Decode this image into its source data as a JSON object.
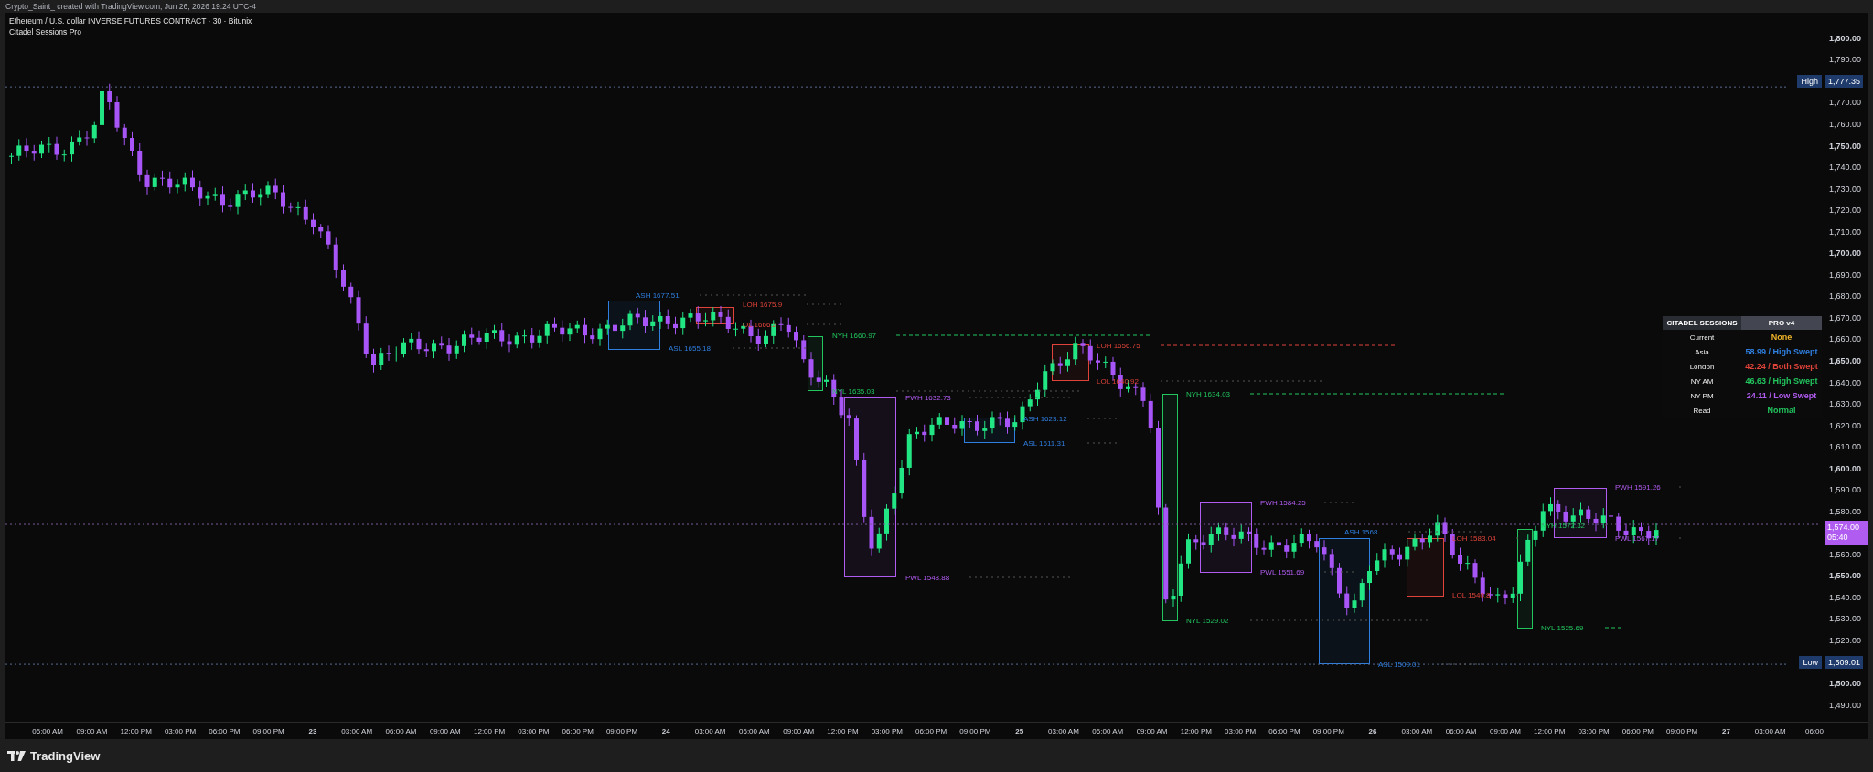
{
  "header": {
    "text": "Crypto_Saint_ created with TradingView.com, Jun 26, 2026 19:24 UTC-4"
  },
  "legend": {
    "symbol": "Ethereum / U.S. dollar INVERSE FUTURES CONTRACT · 30 · Bitunix",
    "indicator": "Citadel Sessions Pro"
  },
  "sessions": [
    {
      "high_label": "ASH 1677.51",
      "low_label": "ASL 1655.18",
      "color": "#2f7fe0",
      "high_line": false,
      "low_line": false
    },
    {
      "high_label": "LOH 1675.9",
      "low_label": "OL 1666.2",
      "color": "#e0433a",
      "high_line": false,
      "low_line": false
    },
    {
      "high_label": "NYH 1660.97",
      "low_label": "NYL 1635.03",
      "color": "#22c55e",
      "high_line": true,
      "low_line": false
    },
    {
      "high_label": "PWH 1632.73",
      "low_label": "PWL 1548.88",
      "color": "#b15cf0",
      "high_line": false,
      "low_line": false
    },
    {
      "high_label": "ASH 1623.12",
      "low_label": "ASL 1611.31",
      "color": "#2f7fe0",
      "high_line": false,
      "low_line": false
    },
    {
      "high_label": "LOH 1656.75",
      "low_label": "LOL 1640.92",
      "color": "#e0433a",
      "high_line": true,
      "low_line": false
    },
    {
      "high_label": "NYH 1634.03",
      "low_label": "NYL 1529.02",
      "color": "#22c55e",
      "high_line": true,
      "low_line": false
    },
    {
      "high_label": "PWH 1584.25",
      "low_label": "PWL 1551.69",
      "color": "#b15cf0",
      "high_line": false,
      "low_line": false
    },
    {
      "high_label": "ASH 1568",
      "low_label": "ASL 1509.01",
      "color": "#2f7fe0",
      "high_line": false,
      "low_line": false
    },
    {
      "high_label": "LOH 1583.04",
      "low_label": "LOL 1540.8",
      "color": "#e0433a",
      "high_line": false,
      "low_line": false
    },
    {
      "high_label": "NYH 1572.32",
      "low_label": "NYL 1525.69",
      "color": "#22c55e",
      "high_line": false,
      "low_line": true
    },
    {
      "high_label": "PWH 1591.26",
      "low_label": "PWL 1567.17",
      "color": "#b15cf0",
      "high_line": false,
      "low_line": false
    }
  ],
  "sessions_table": {
    "title": "CITADEL SESSIONS",
    "version": "PRO v4",
    "rows": [
      {
        "label": "Current",
        "value": "None",
        "color": "#f0b429"
      },
      {
        "label": "Asia",
        "value": "58.99 / High Swept",
        "color": "#2f7fe0"
      },
      {
        "label": "London",
        "value": "42.24 / Both Swept",
        "color": "#e0433a"
      },
      {
        "label": "NY AM",
        "value": "46.63 / High Swept",
        "color": "#22c55e"
      },
      {
        "label": "NY PM",
        "value": "24.11 / Low Swept",
        "color": "#b15cf0"
      },
      {
        "label": "Read",
        "value": "Normal",
        "color": "#22c55e"
      }
    ]
  },
  "price_axis": [
    {
      "kind": "tick",
      "label": "1,800.00",
      "major": true
    },
    {
      "kind": "tick",
      "label": "1,790.00",
      "major": false
    },
    {
      "kind": "tag",
      "tag": "High",
      "label": "1,777.35"
    },
    {
      "kind": "tick",
      "label": "1,770.00",
      "major": false
    },
    {
      "kind": "tick",
      "label": "1,760.00",
      "major": false
    },
    {
      "kind": "tick",
      "label": "1,750.00",
      "major": true
    },
    {
      "kind": "tick",
      "label": "1,740.00",
      "major": false
    },
    {
      "kind": "tick",
      "label": "1,730.00",
      "major": false
    },
    {
      "kind": "tick",
      "label": "1,720.00",
      "major": false
    },
    {
      "kind": "tick",
      "label": "1,710.00",
      "major": false
    },
    {
      "kind": "tick",
      "label": "1,700.00",
      "major": true
    },
    {
      "kind": "tick",
      "label": "1,690.00",
      "major": false
    },
    {
      "kind": "tick",
      "label": "1,680.00",
      "major": false
    },
    {
      "kind": "tick",
      "label": "1,670.00",
      "major": false
    },
    {
      "kind": "tick",
      "label": "1,660.00",
      "major": false
    },
    {
      "kind": "tick",
      "label": "1,650.00",
      "major": true
    },
    {
      "kind": "tick",
      "label": "1,640.00",
      "major": false
    },
    {
      "kind": "tick",
      "label": "1,630.00",
      "major": false
    },
    {
      "kind": "tick",
      "label": "1,620.00",
      "major": false
    },
    {
      "kind": "tick",
      "label": "1,610.00",
      "major": false
    },
    {
      "kind": "tick",
      "label": "1,600.00",
      "major": true
    },
    {
      "kind": "tick",
      "label": "1,590.00",
      "major": false
    },
    {
      "kind": "tick",
      "label": "1,580.00",
      "major": false
    },
    {
      "kind": "price",
      "label": "1,574.00",
      "countdown": "05:40"
    },
    {
      "kind": "tick",
      "label": "1,560.00",
      "major": false
    },
    {
      "kind": "tick",
      "label": "1,550.00",
      "major": true
    },
    {
      "kind": "tick",
      "label": "1,540.00",
      "major": false
    },
    {
      "kind": "tick",
      "label": "1,530.00",
      "major": false
    },
    {
      "kind": "tick",
      "label": "1,520.00",
      "major": false
    },
    {
      "kind": "tag",
      "tag": "Low",
      "label": "1,509.01"
    },
    {
      "kind": "tick",
      "label": "1,500.00",
      "major": true
    },
    {
      "kind": "tick",
      "label": "1,490.00",
      "major": false
    }
  ],
  "time_axis": [
    {
      "label": "06:00 AM",
      "major": false
    },
    {
      "label": "09:00 AM",
      "major": false
    },
    {
      "label": "12:00 PM",
      "major": false
    },
    {
      "label": "03:00 PM",
      "major": false
    },
    {
      "label": "06:00 PM",
      "major": false
    },
    {
      "label": "09:00 PM",
      "major": false
    },
    {
      "label": "23",
      "major": true
    },
    {
      "label": "03:00 AM",
      "major": false
    },
    {
      "label": "06:00 AM",
      "major": false
    },
    {
      "label": "09:00 AM",
      "major": false
    },
    {
      "label": "12:00 PM",
      "major": false
    },
    {
      "label": "03:00 PM",
      "major": false
    },
    {
      "label": "06:00 PM",
      "major": false
    },
    {
      "label": "09:00 PM",
      "major": false
    },
    {
      "label": "24",
      "major": true
    },
    {
      "label": "03:00 AM",
      "major": false
    },
    {
      "label": "06:00 AM",
      "major": false
    },
    {
      "label": "09:00 AM",
      "major": false
    },
    {
      "label": "12:00 PM",
      "major": false
    },
    {
      "label": "03:00 PM",
      "major": false
    },
    {
      "label": "06:00 PM",
      "major": false
    },
    {
      "label": "09:00 PM",
      "major": false
    },
    {
      "label": "25",
      "major": true
    },
    {
      "label": "03:00 AM",
      "major": false
    },
    {
      "label": "06:00 AM",
      "major": false
    },
    {
      "label": "09:00 AM",
      "major": false
    },
    {
      "label": "12:00 PM",
      "major": false
    },
    {
      "label": "03:00 PM",
      "major": false
    },
    {
      "label": "06:00 PM",
      "major": false
    },
    {
      "label": "09:00 PM",
      "major": false
    },
    {
      "label": "26",
      "major": true
    },
    {
      "label": "03:00 AM",
      "major": false
    },
    {
      "label": "06:00 AM",
      "major": false
    },
    {
      "label": "09:00 AM",
      "major": false
    },
    {
      "label": "12:00 PM",
      "major": false
    },
    {
      "label": "03:00 PM",
      "major": false
    },
    {
      "label": "06:00 PM",
      "major": false
    },
    {
      "label": "09:00 PM",
      "major": false
    },
    {
      "label": "27",
      "major": true
    },
    {
      "label": "03:00 AM",
      "major": false
    },
    {
      "label": "06:00",
      "major": false
    }
  ],
  "footer": {
    "brand": "TradingView"
  }
}
